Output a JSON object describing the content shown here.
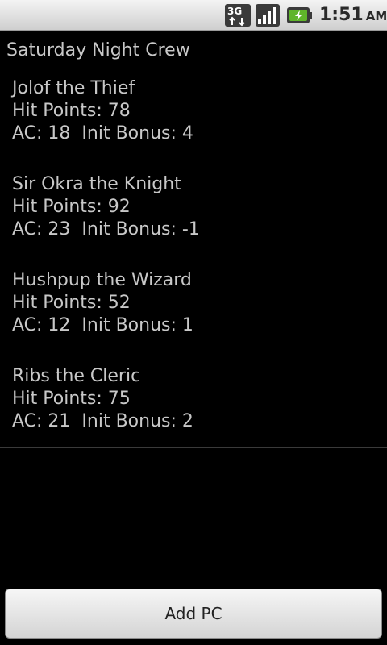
{
  "status_bar": {
    "network_label": "3G",
    "network_icon": "3g-data-icon",
    "signal_icon": "signal-strength-icon",
    "battery_icon": "battery-charging-icon",
    "time": "1:51",
    "ampm": "AM",
    "battery_color": "#5fb52a"
  },
  "group": {
    "title": "Saturday Night Crew"
  },
  "characters": [
    {
      "name": "Jolof the Thief",
      "hp_line": "Hit Points: 78",
      "stats_line": "AC: 18  Init Bonus: 4"
    },
    {
      "name": "Sir Okra the Knight",
      "hp_line": "Hit Points: 92",
      "stats_line": "AC: 23  Init Bonus: -1"
    },
    {
      "name": "Hushpup the Wizard",
      "hp_line": "Hit Points: 52",
      "stats_line": "AC: 12  Init Bonus: 1"
    },
    {
      "name": "Ribs the Cleric",
      "hp_line": "Hit Points: 75",
      "stats_line": "AC: 21  Init Bonus: 2"
    }
  ],
  "actions": {
    "add_label": "Add PC"
  }
}
